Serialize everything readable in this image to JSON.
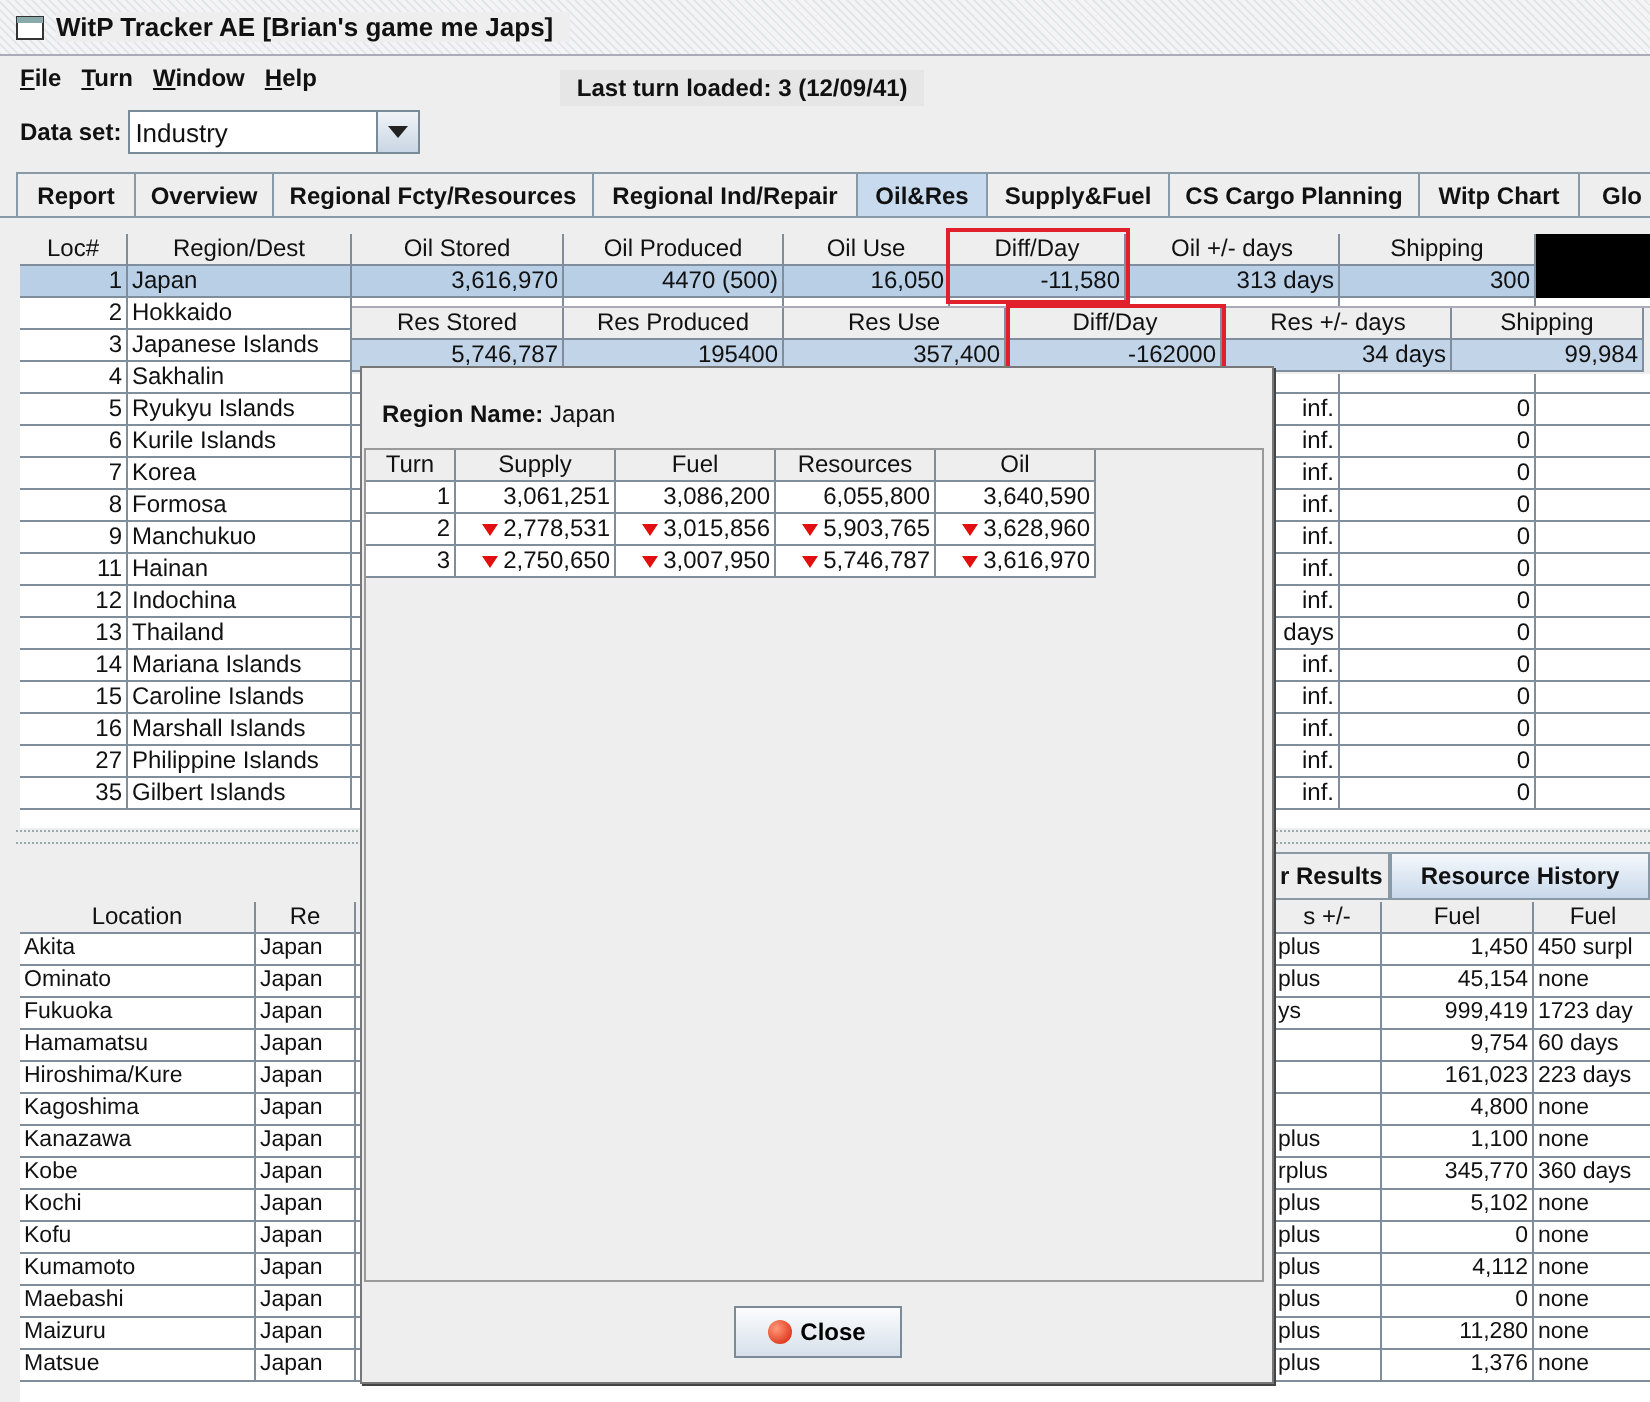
{
  "window": {
    "title": "WitP Tracker AE [Brian's game me Japs]"
  },
  "menu": [
    {
      "label": "File"
    },
    {
      "label": "Turn"
    },
    {
      "label": "Window"
    },
    {
      "label": "Help"
    }
  ],
  "last_turn": "Last turn loaded: 3 (12/09/41)",
  "data_set": {
    "label": "Data set:",
    "value": "Industry"
  },
  "tabs": [
    {
      "label": "Report",
      "selected": false
    },
    {
      "label": "Overview",
      "selected": false
    },
    {
      "label": "Regional Fcty/Resources",
      "selected": false
    },
    {
      "label": "Regional Ind/Repair",
      "selected": false
    },
    {
      "label": "Oil&Res",
      "selected": true
    },
    {
      "label": "Supply&Fuel",
      "selected": false
    },
    {
      "label": "CS Cargo Planning",
      "selected": false
    },
    {
      "label": "Witp Chart",
      "selected": false
    },
    {
      "label": "Glo",
      "selected": false
    }
  ],
  "oil_table": {
    "redacted": true,
    "columns": [
      {
        "label": "Loc#",
        "highlighted": false
      },
      {
        "label": "Region/Dest",
        "highlighted": false
      },
      {
        "label": "Oil Stored",
        "highlighted": false
      },
      {
        "label": "Oil Produced",
        "highlighted": false
      },
      {
        "label": "Oil Use",
        "highlighted": false
      },
      {
        "label": "Diff/Day",
        "highlighted": true
      },
      {
        "label": "Oil +/- days",
        "highlighted": false
      },
      {
        "label": "Shipping",
        "highlighted": false
      }
    ],
    "rows": [
      {
        "selected": true,
        "cells": [
          "1",
          "Japan",
          "3,616,970",
          "4470 (500)",
          "16,050",
          "-11,580",
          "313 days",
          "300"
        ]
      },
      {
        "selected": false,
        "cells": [
          "2",
          "Hokkaido"
        ]
      },
      {
        "selected": false,
        "cells": [
          "3",
          "Japanese Islands"
        ]
      },
      {
        "selected": false,
        "cells": [
          "4",
          "Sakhalin"
        ]
      },
      {
        "selected": false,
        "cells": [
          "5",
          "Ryukyu Islands",
          null,
          null,
          null,
          null,
          "inf.",
          "0"
        ]
      },
      {
        "selected": false,
        "cells": [
          "6",
          "Kurile Islands",
          null,
          null,
          null,
          null,
          "inf.",
          "0"
        ]
      },
      {
        "selected": false,
        "cells": [
          "7",
          "Korea",
          null,
          null,
          null,
          null,
          "inf.",
          "0"
        ]
      },
      {
        "selected": false,
        "cells": [
          "8",
          "Formosa",
          null,
          null,
          null,
          null,
          "inf.",
          "0"
        ]
      },
      {
        "selected": false,
        "cells": [
          "9",
          "Manchukuo",
          null,
          null,
          null,
          null,
          "inf.",
          "0"
        ]
      },
      {
        "selected": false,
        "cells": [
          "11",
          "Hainan",
          null,
          null,
          null,
          null,
          "inf.",
          "0"
        ]
      },
      {
        "selected": false,
        "cells": [
          "12",
          "Indochina",
          null,
          null,
          null,
          null,
          "inf.",
          "0"
        ]
      },
      {
        "selected": false,
        "cells": [
          "13",
          "Thailand",
          null,
          null,
          null,
          null,
          "days",
          "0"
        ]
      },
      {
        "selected": false,
        "cells": [
          "14",
          "Mariana Islands",
          null,
          null,
          null,
          null,
          "inf.",
          "0"
        ]
      },
      {
        "selected": false,
        "cells": [
          "15",
          "Caroline Islands",
          null,
          null,
          null,
          null,
          "inf.",
          "0"
        ]
      },
      {
        "selected": false,
        "cells": [
          "16",
          "Marshall Islands",
          null,
          null,
          null,
          null,
          "inf.",
          "0"
        ]
      },
      {
        "selected": false,
        "cells": [
          "27",
          "Philippine Islands",
          null,
          null,
          null,
          null,
          "inf.",
          "0"
        ]
      },
      {
        "selected": false,
        "cells": [
          "35",
          "Gilbert Islands",
          null,
          null,
          null,
          null,
          "inf.",
          "0"
        ]
      }
    ]
  },
  "res_table": {
    "columns": [
      {
        "label": "Res Stored",
        "highlighted": false
      },
      {
        "label": "Res Produced",
        "highlighted": false
      },
      {
        "label": "Res Use",
        "highlighted": false
      },
      {
        "label": "Diff/Day",
        "highlighted": true
      },
      {
        "label": "Res +/- days",
        "highlighted": false
      },
      {
        "label": "Shipping",
        "highlighted": false
      }
    ],
    "values": [
      "5,746,787",
      "195400",
      "357,400",
      "-162000",
      "34 days",
      "99,984"
    ]
  },
  "lower_panel": {
    "tabs": [
      {
        "label": "r Results",
        "selected": false
      },
      {
        "label": "Resource History",
        "selected": true
      }
    ],
    "columns": [
      "Location",
      "Re",
      "s +/-",
      "Fuel",
      "Fuel"
    ],
    "rows": [
      {
        "cells": [
          "Akita",
          "Japan",
          "plus",
          "1,450",
          "450 surpl"
        ]
      },
      {
        "cells": [
          "Ominato",
          "Japan",
          "plus",
          "45,154",
          "none"
        ]
      },
      {
        "cells": [
          "Fukuoka",
          "Japan",
          "ys",
          "999,419",
          "1723 day"
        ]
      },
      {
        "cells": [
          "Hamamatsu",
          "Japan",
          null,
          "9,754",
          "60 days"
        ]
      },
      {
        "cells": [
          "Hiroshima/Kure",
          "Japan",
          null,
          "161,023",
          "223 days"
        ]
      },
      {
        "cells": [
          "Kagoshima",
          "Japan",
          null,
          "4,800",
          "none"
        ]
      },
      {
        "cells": [
          "Kanazawa",
          "Japan",
          "plus",
          "1,100",
          "none"
        ]
      },
      {
        "cells": [
          "Kobe",
          "Japan",
          "rplus",
          "345,770",
          "360 days"
        ]
      },
      {
        "cells": [
          "Kochi",
          "Japan",
          "plus",
          "5,102",
          "none"
        ]
      },
      {
        "cells": [
          "Kofu",
          "Japan",
          "plus",
          "0",
          "none"
        ]
      },
      {
        "cells": [
          "Kumamoto",
          "Japan",
          "plus",
          "4,112",
          "none"
        ]
      },
      {
        "cells": [
          "Maebashi",
          "Japan",
          "plus",
          "0",
          "none"
        ]
      },
      {
        "cells": [
          "Maizuru",
          "Japan",
          "plus",
          "11,280",
          "none"
        ]
      },
      {
        "cells": [
          "Matsue",
          "Japan",
          "plus",
          "1,376",
          "none"
        ]
      }
    ]
  },
  "dialog": {
    "heading": "**Region Name:** Japan",
    "columns": [
      "Turn",
      "Supply",
      "Fuel",
      "Resources",
      "Oil"
    ],
    "rows": [
      {
        "decreased": false,
        "cells": [
          "1",
          "3,061,251",
          "3,086,200",
          "6,055,800",
          "3,640,590"
        ]
      },
      {
        "decreased": true,
        "cells": [
          "2",
          "2,778,531",
          "3,015,856",
          "5,903,765",
          "3,628,960"
        ]
      },
      {
        "decreased": true,
        "cells": [
          "3",
          "2,750,650",
          "3,007,950",
          "5,746,787",
          "3,616,970"
        ]
      }
    ],
    "button": "Close"
  }
}
